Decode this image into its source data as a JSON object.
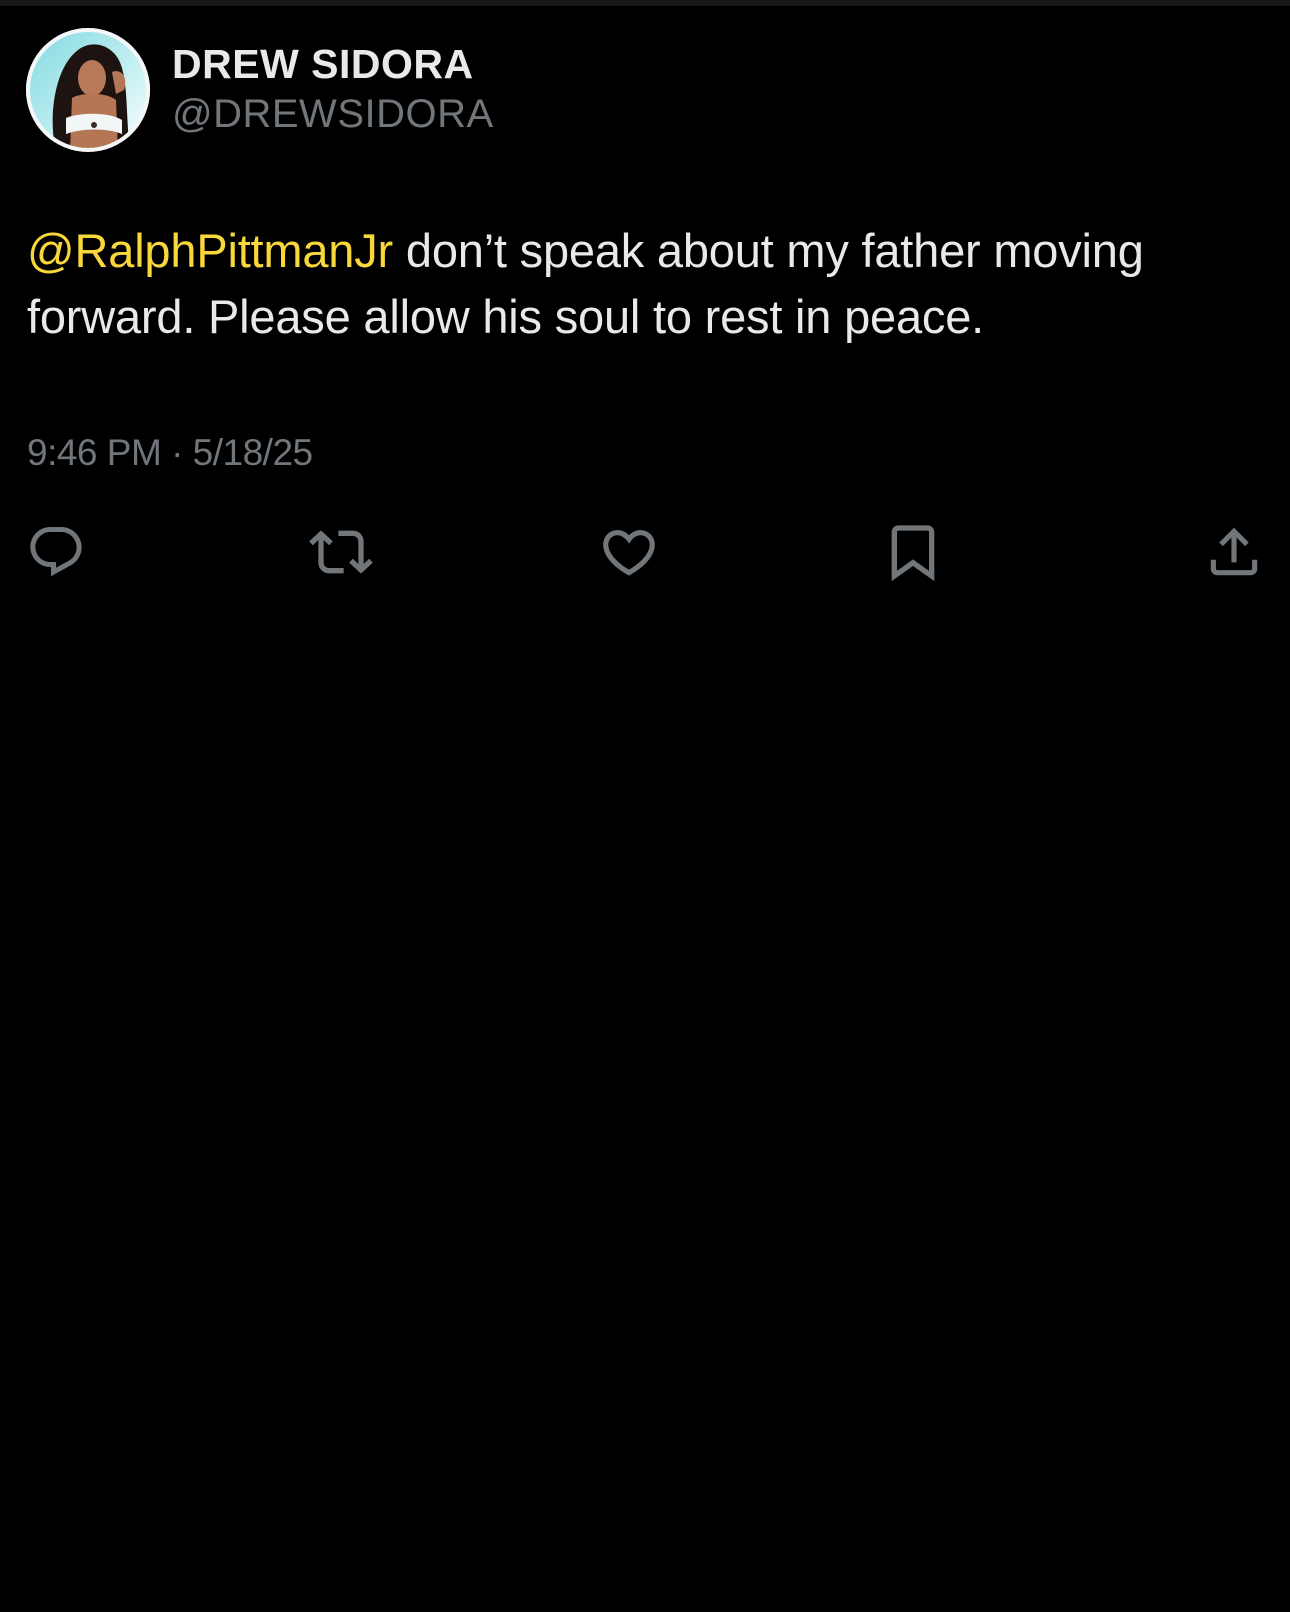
{
  "tweet": {
    "display_name": "DREW SIDORA",
    "handle": "@DREWSIDORA",
    "mention": "@RalphPittmanJr",
    "text": " don’t speak about my father moving forward. Please allow his soul to rest in peace.",
    "timestamp": "9:46 PM · 5/18/25"
  },
  "actions": [
    {
      "name": "reply",
      "icon": "reply-icon"
    },
    {
      "name": "retweet",
      "icon": "retweet-icon"
    },
    {
      "name": "like",
      "icon": "heart-icon"
    },
    {
      "name": "bookmark",
      "icon": "bookmark-icon"
    },
    {
      "name": "share",
      "icon": "share-icon"
    }
  ],
  "colors": {
    "background": "#000000",
    "primary_text": "#e7e9ea",
    "secondary_text": "#71767b",
    "mention": "#f7d73a",
    "icon": "#71767b"
  }
}
